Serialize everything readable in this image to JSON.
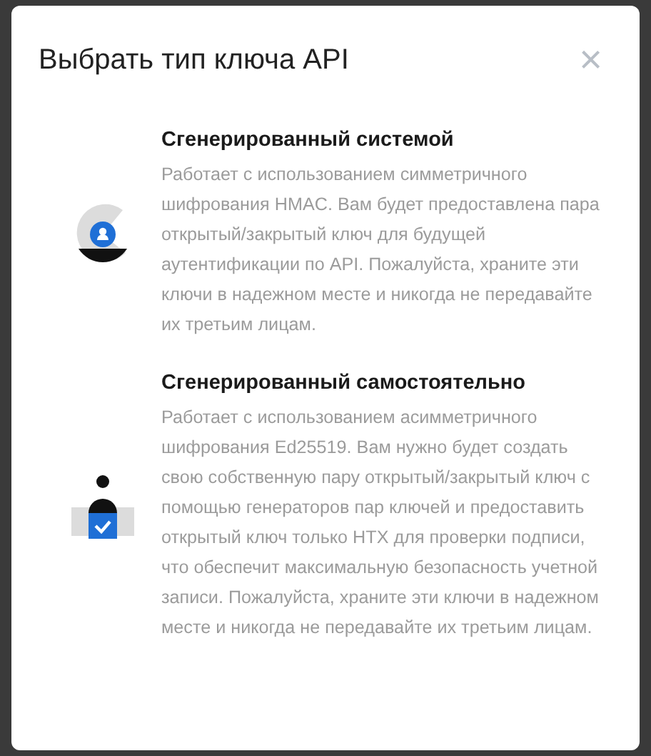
{
  "dialog": {
    "title": "Выбрать тип ключа API",
    "close": "×"
  },
  "options": [
    {
      "kind": "system",
      "title": "Сгенерированный системой",
      "description": "Работает с использованием симметричного шифрования HMAC. Вам будет предоставлена пара открытый/закрытый ключ для будущей аутентификации по API. Пожалуйста, храните эти ключи в надежном месте и никогда не передавайте их третьим лицам."
    },
    {
      "kind": "self",
      "title": "Сгенерированный самостоятельно",
      "description": "Работает с использованием асимметричного шифрования Ed25519. Вам нужно будет создать свою собственную пару открытый/закрытый ключ с помощью генераторов пар ключей и предоставить открытый ключ только HTX для проверки подписи, что обеспечит максимальную безопасность учетной записи. Пожалуйста, храните эти ключи в надежном месте и никогда не передавайте их третьим лицам."
    }
  ]
}
